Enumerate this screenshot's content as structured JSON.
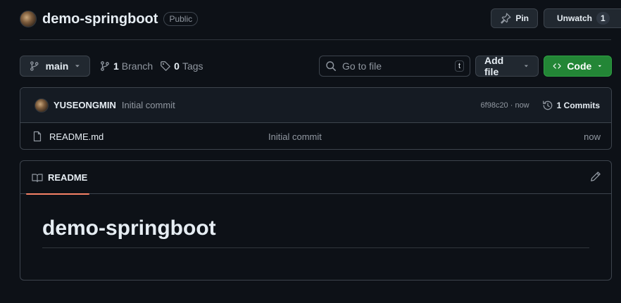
{
  "repo": {
    "name": "demo-springboot",
    "visibility": "Public"
  },
  "header_actions": {
    "pin_label": "Pin",
    "unwatch_label": "Unwatch",
    "watch_count": "1"
  },
  "toolbar": {
    "branch": "main",
    "branches_count": "1",
    "branches_label": "Branch",
    "tags_count": "0",
    "tags_label": "Tags",
    "search_placeholder": "Go to file",
    "search_shortcut": "t",
    "add_file_label": "Add file",
    "code_label": "Code"
  },
  "latest_commit": {
    "author": "YUSEONGMIN",
    "message": "Initial commit",
    "hash_time": "6f98c20 · now",
    "commits_label": "1 Commits"
  },
  "files": [
    {
      "name": "README.md",
      "message": "Initial commit",
      "time": "now"
    }
  ],
  "readme": {
    "tab_label": "README",
    "heading": "demo-springboot"
  },
  "colors": {
    "background": "#0d1117",
    "border": "#3d444d",
    "code_button": "#238636",
    "tab_underline": "#f78166"
  }
}
